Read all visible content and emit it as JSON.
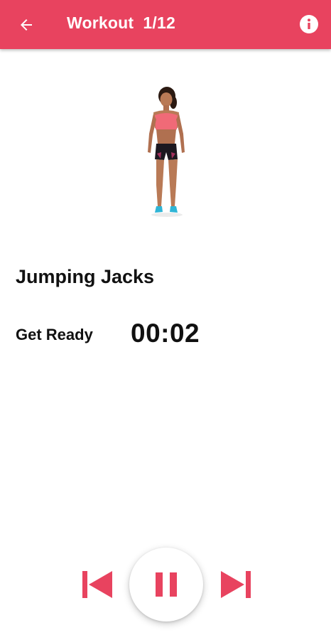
{
  "appbar": {
    "title": "Workout  1/12",
    "background_color": "#e8435f",
    "back_icon": "arrow-left-icon",
    "info_icon": "info-icon"
  },
  "exercise": {
    "name": "Jumping Jacks",
    "illustration": "woman-standing-figure"
  },
  "status": {
    "label": "Get Ready",
    "timer": "00:02"
  },
  "controls": {
    "accent_color": "#e8435f",
    "previous_icon": "skip-previous-icon",
    "pause_icon": "pause-icon",
    "next_icon": "skip-next-icon"
  }
}
